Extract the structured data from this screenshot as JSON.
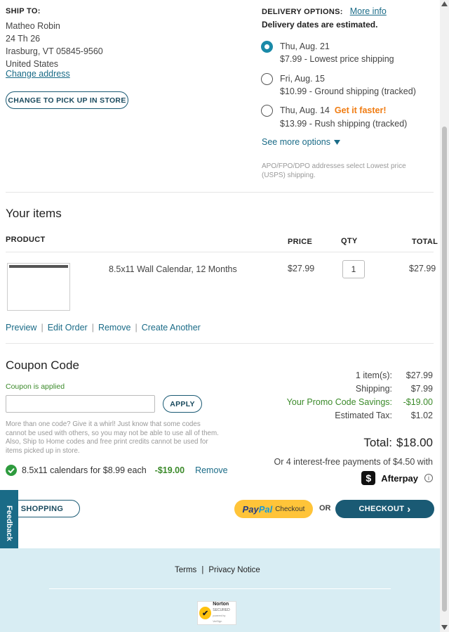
{
  "ship_to": {
    "label": "SHIP TO:",
    "name": "Matheo Robin",
    "street": "24 Th 26",
    "city": "Irasburg, VT 05845-9560",
    "country": "United States",
    "change_address": "Change address",
    "pickup_button": "CHANGE TO PICK UP IN STORE"
  },
  "delivery": {
    "label": "DELIVERY OPTIONS:",
    "more_info": "More info",
    "note": "Delivery dates are estimated.",
    "options": [
      {
        "date": "Thu, Aug. 21",
        "tag": "",
        "detail": "$7.99 - Lowest price shipping",
        "selected": true
      },
      {
        "date": "Fri, Aug. 15",
        "tag": "",
        "detail": "$10.99 - Ground shipping (tracked)",
        "selected": false
      },
      {
        "date": "Thu, Aug. 14",
        "tag": "Get it faster!",
        "detail": "$13.99 - Rush shipping (tracked)",
        "selected": false
      }
    ],
    "see_more": "See more options",
    "apo_note": "APO/FPO/DPO addresses select Lowest price (USPS) shipping."
  },
  "items": {
    "title": "Your items",
    "headers": {
      "product": "PRODUCT",
      "price": "PRICE",
      "qty": "QTY",
      "total": "TOTAL"
    },
    "rows": [
      {
        "name": "8.5x11 Wall Calendar, 12 Months",
        "price": "$27.99",
        "qty": "1",
        "total": "$27.99"
      }
    ],
    "actions": {
      "preview": "Preview",
      "edit": "Edit Order",
      "remove": "Remove",
      "create": "Create Another"
    },
    "sep": "|"
  },
  "coupon": {
    "title": "Coupon Code",
    "applied": "Coupon is applied",
    "input_value": "",
    "apply": "APPLY",
    "help": "More than one code? Give it a whirl! Just know that some codes cannot be used with others, so you may not be able to use all of them. Also, Ship to Home codes and free print credits cannot be used for items picked up in store.",
    "promo_label": "8.5x11 calendars for $8.99 each",
    "promo_amount": "-$19.00",
    "promo_remove": "Remove"
  },
  "summary": {
    "items_label": "1 item(s):",
    "items_value": "$27.99",
    "shipping_label": "Shipping:",
    "shipping_value": "$7.99",
    "promo_label": "Your Promo Code Savings:",
    "promo_value": "-$19.00",
    "tax_label": "Estimated Tax:",
    "tax_value": "$1.02",
    "total_label": "Total:",
    "total_value": "$18.00",
    "installments": "Or 4 interest-free payments of $4.50 with",
    "afterpay": "Afterpay",
    "afterpay_info": "i"
  },
  "buttons": {
    "keep_shopping": "EEP SHOPPING",
    "paypal_pay": "Pay",
    "paypal_pal": "Pal",
    "paypal_checkout": "Checkout",
    "or": "OR",
    "checkout": "CHECKOUT",
    "checkout_arrow": "›",
    "feedback": "Feedback"
  },
  "footer": {
    "terms": "Terms",
    "sep": "|",
    "privacy": "Privacy Notice",
    "badge_title": "Norton",
    "badge_sub": "SECURED",
    "badge_small": "powered by VeriSign",
    "badge_check": "✔"
  },
  "colors": {
    "accent": "#1a5a74",
    "radio_selected": "#1a8aa8",
    "footer_bg": "#d8edf3",
    "paypal_yellow": "#ffc439",
    "get_faster": "#f07c12",
    "green": "#3b8a2a"
  }
}
